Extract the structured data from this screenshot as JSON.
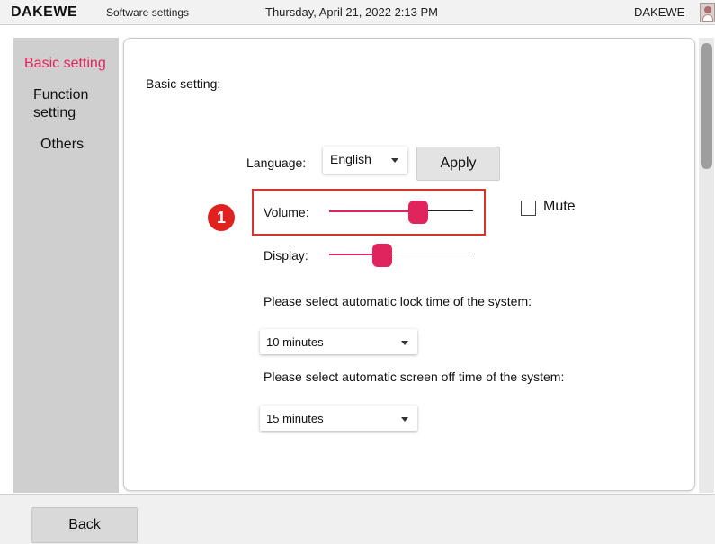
{
  "topbar": {
    "logo": "DAKEWE",
    "title": "Software settings",
    "datetime": "Thursday, April 21, 2022  2:13 PM",
    "user": "DAKEWE",
    "avatar_icon": "user-avatar-icon"
  },
  "sidebar": {
    "items": [
      {
        "label": "Basic setting",
        "active": true
      },
      {
        "label": "Function setting",
        "active": false
      },
      {
        "label": "Others",
        "active": false
      }
    ]
  },
  "main": {
    "heading": "Basic setting:",
    "language": {
      "label": "Language:",
      "value": "English"
    },
    "apply_label": "Apply",
    "annotation_number": "1",
    "volume": {
      "label": "Volume:",
      "level": 0.62
    },
    "mute": {
      "label": "Mute",
      "checked": false
    },
    "display": {
      "label": "Display:",
      "level": 0.37
    },
    "lock_time": {
      "question": "Please select automatic lock time of the system:",
      "value": "10 minutes"
    },
    "screen_off": {
      "question": "Please select automatic screen off time of the system:",
      "value": "15 minutes"
    }
  },
  "footer": {
    "back_label": "Back"
  },
  "colors": {
    "accent": "#e0245e",
    "highlight": "#d9342b",
    "sidebar": "#cfcfcf"
  }
}
